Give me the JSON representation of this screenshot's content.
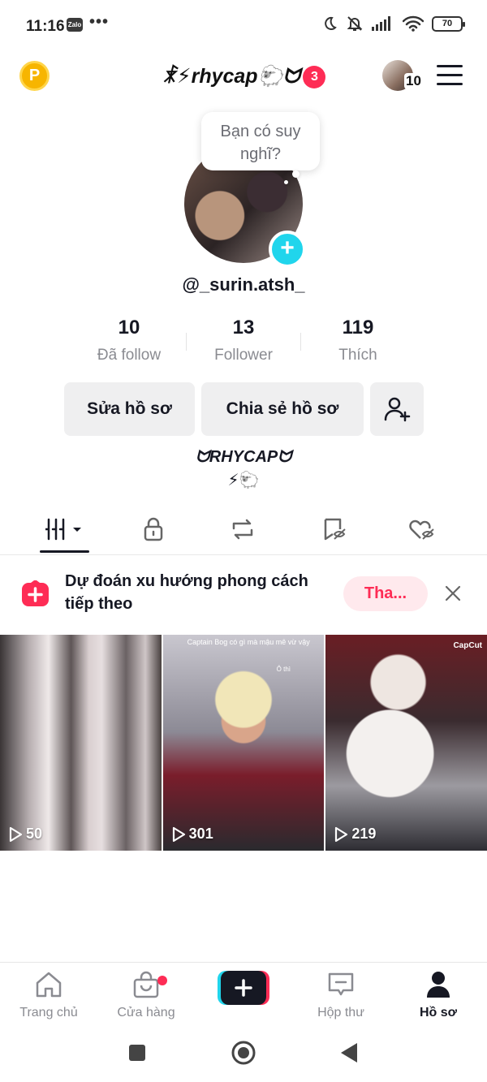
{
  "status_bar": {
    "time": "11:16",
    "zalo": "Zalo",
    "more": "•••",
    "battery": "70"
  },
  "header": {
    "title": "ꍡ⚡rhycap🐑ᗢ",
    "notification_count": "3",
    "avatar_count": "10",
    "coin_letter": "P"
  },
  "profile": {
    "tooltip": "Bạn có suy nghĩ?",
    "username": "@_surin.atsh_",
    "stats": [
      {
        "value": "10",
        "label": "Đã follow"
      },
      {
        "value": "13",
        "label": "Follower"
      },
      {
        "value": "119",
        "label": "Thích"
      }
    ],
    "edit_label": "Sửa hồ sơ",
    "share_label": "Chia sẻ hồ sơ",
    "bio_line1": "ᗢRHYCAPᗢ",
    "bio_line2": "⚡🐑"
  },
  "promo": {
    "text": "Dự đoán xu hướng phong cách tiếp theo",
    "button": "Tha..."
  },
  "videos": [
    {
      "views": "50"
    },
    {
      "views": "301",
      "caption": "Captain Bog có gì mà mậu mê vừ vậy",
      "tag": "Ô thì"
    },
    {
      "views": "219",
      "watermark": "CapCut"
    }
  ],
  "bottom_nav": {
    "home": "Trang chủ",
    "shop": "Cửa hàng",
    "inbox": "Hộp thư",
    "profile": "Hồ sơ"
  },
  "colors": {
    "accent": "#fe2c55",
    "cyan": "#20d5ec",
    "text": "#161823",
    "muted": "#8a8b91"
  }
}
